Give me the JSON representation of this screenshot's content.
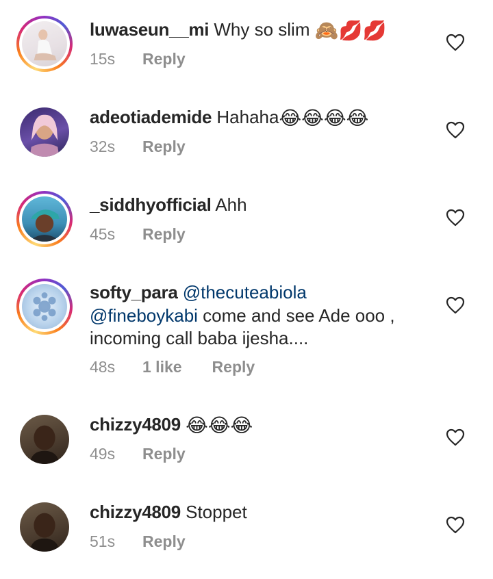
{
  "comments": [
    {
      "username": "luwaseun__mi",
      "text": "Why so slim",
      "emoji": "🙈💋💋",
      "time": "15s",
      "likes": "",
      "reply": "Reply"
    },
    {
      "username": "adeotiademide",
      "text": "Hahaha",
      "emoji": "😂😂😂😂",
      "time": "32s",
      "likes": "",
      "reply": "Reply"
    },
    {
      "username": "_siddhyofficial",
      "text": "Ahh",
      "emoji": "",
      "time": "45s",
      "likes": "",
      "reply": "Reply"
    },
    {
      "username": "softy_para",
      "mention1": "@thecuteabiola",
      "mention2": "@fineboykabi",
      "text": " come and see Ade ooo ,",
      "text2": "incoming call baba ijesha....",
      "time": "48s",
      "likes": "1 like",
      "reply": "Reply"
    },
    {
      "username": "chizzy4809",
      "text": "",
      "emoji": "😂😂😂",
      "time": "49s",
      "likes": "",
      "reply": "Reply"
    },
    {
      "username": "chizzy4809",
      "text": "Stoppet",
      "emoji": "",
      "time": "51s",
      "likes": "",
      "reply": "Reply"
    }
  ],
  "icons": {
    "like": "heart-outline-icon"
  },
  "colors": {
    "text": "#262626",
    "muted": "#8e8e8e",
    "mention": "#00376b"
  }
}
